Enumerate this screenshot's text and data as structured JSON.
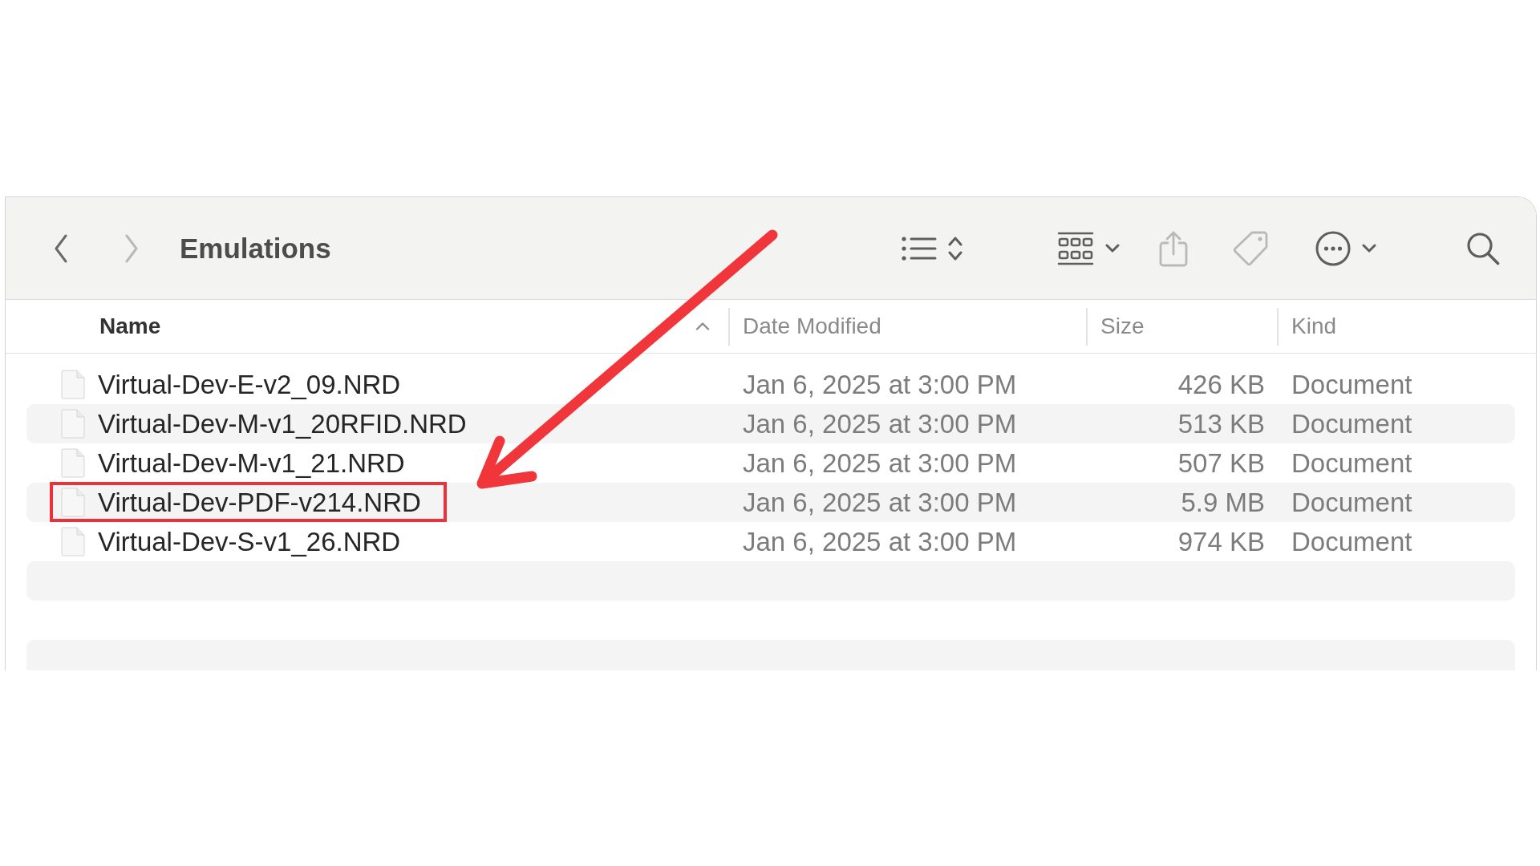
{
  "window": {
    "title": "Emulations"
  },
  "toolbar": {
    "navigation": [
      {
        "kind": "back",
        "disabled": false
      },
      {
        "kind": "forward",
        "disabled": true
      }
    ],
    "tools": [
      {
        "kind": "view-options",
        "disabled": false
      },
      {
        "kind": "group",
        "disabled": false
      },
      {
        "kind": "share",
        "disabled": true
      },
      {
        "kind": "tag",
        "disabled": true
      },
      {
        "kind": "more",
        "disabled": false
      },
      {
        "kind": "search",
        "disabled": false
      }
    ]
  },
  "columns": [
    {
      "label": "Name",
      "sorted": true
    },
    {
      "label": "Date Modified",
      "sorted": false
    },
    {
      "label": "Size",
      "sorted": false
    },
    {
      "label": "Kind",
      "sorted": false
    }
  ],
  "rows": [
    {
      "name": "Virtual-Dev-E-v2_09.NRD",
      "date_modified": "Jan 6, 2025 at 3:00 PM",
      "size": "426 KB",
      "file_kind": "Document",
      "highlighted": false
    },
    {
      "name": "Virtual-Dev-M-v1_20RFID.NRD",
      "date_modified": "Jan 6, 2025 at 3:00 PM",
      "size": "513 KB",
      "file_kind": "Document",
      "highlighted": false
    },
    {
      "name": "Virtual-Dev-M-v1_21.NRD",
      "date_modified": "Jan 6, 2025 at 3:00 PM",
      "size": "507 KB",
      "file_kind": "Document",
      "highlighted": false
    },
    {
      "name": "Virtual-Dev-PDF-v214.NRD",
      "date_modified": "Jan 6, 2025 at 3:00 PM",
      "size": "5.9 MB",
      "file_kind": "Document",
      "highlighted": true
    },
    {
      "name": "Virtual-Dev-S-v1_26.NRD",
      "date_modified": "Jan 6, 2025 at 3:00 PM",
      "size": "974 KB",
      "file_kind": "Document",
      "highlighted": false
    }
  ],
  "annotations": [
    {
      "kind": "arrow"
    }
  ]
}
